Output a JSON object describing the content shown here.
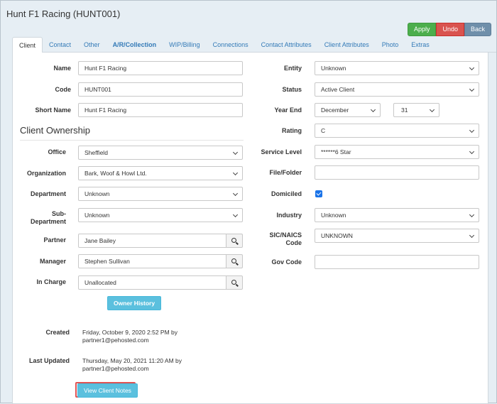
{
  "page": {
    "title": "Hunt F1 Racing (HUNT001)"
  },
  "actions": {
    "apply": "Apply",
    "undo": "Undo",
    "back": "Back"
  },
  "tabs": [
    {
      "label": "Client",
      "active": true
    },
    {
      "label": "Contact"
    },
    {
      "label": "Other"
    },
    {
      "label": "A/R/Collection",
      "bold": true
    },
    {
      "label": "WIP/Billing"
    },
    {
      "label": "Connections"
    },
    {
      "label": "Contact Attributes"
    },
    {
      "label": "Client Attributes"
    },
    {
      "label": "Photo"
    },
    {
      "label": "Extras"
    }
  ],
  "left": {
    "name": {
      "label": "Name",
      "value": "Hunt F1 Racing"
    },
    "code": {
      "label": "Code",
      "value": "HUNT001"
    },
    "short_name": {
      "label": "Short Name",
      "value": "Hunt F1 Racing"
    },
    "section_title": "Client Ownership",
    "office": {
      "label": "Office",
      "value": "Sheffield"
    },
    "organization": {
      "label": "Organization",
      "value": "Bark, Woof & Howl Ltd."
    },
    "department": {
      "label": "Department",
      "value": "Unknown"
    },
    "sub_department": {
      "label_line1": "Sub-",
      "label_line2": "Department",
      "value": "Unknown"
    },
    "partner": {
      "label": "Partner",
      "value": "Jane Bailey"
    },
    "manager": {
      "label": "Manager",
      "value": "Stephen Sullivan"
    },
    "in_charge": {
      "label": "In Charge",
      "value": "Unallocated"
    },
    "owner_history_button": "Owner History",
    "created": {
      "label": "Created",
      "line1": "Friday, October 9, 2020 2:52 PM by",
      "line2": "partner1@pehosted.com"
    },
    "last_updated": {
      "label": "Last Updated",
      "line1": "Thursday, May 20, 2021 11:20 AM by",
      "line2": "partner1@pehosted.com"
    },
    "view_notes_button": "View Client Notes"
  },
  "right": {
    "entity": {
      "label": "Entity",
      "value": "Unknown"
    },
    "status": {
      "label": "Status",
      "value": "Active Client"
    },
    "year_end": {
      "label": "Year End",
      "month": "December",
      "day": "31"
    },
    "rating": {
      "label": "Rating",
      "value": "C"
    },
    "service_level": {
      "label": "Service Level",
      "value": "******6 Star"
    },
    "file_folder": {
      "label": "File/Folder",
      "value": ""
    },
    "domiciled": {
      "label": "Domiciled",
      "checked": true
    },
    "industry": {
      "label": "Industry",
      "value": "Unknown"
    },
    "sic_naics": {
      "label_line1": "SIC/NAICS",
      "label_line2": "Code",
      "value": "UNKNOWN"
    },
    "gov_code": {
      "label": "Gov Code",
      "value": ""
    }
  },
  "colors": {
    "apply": "#4cae4c",
    "undo": "#d9534f",
    "back": "#6f8faa",
    "info": "#5bc0de",
    "highlight": "#e05454",
    "link": "#337ab7"
  },
  "icons": {
    "lookup": "search-icon",
    "dropdown": "chevron-down-icon",
    "check": "checkmark-icon"
  }
}
